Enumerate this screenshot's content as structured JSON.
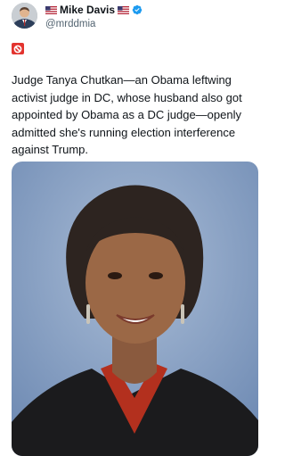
{
  "author": {
    "display_name": "Mike Davis",
    "handle": "@mrddmia",
    "avatar_icon": "avatar-photo",
    "flag_icon": "us-flag-icon",
    "verified_icon": "verified-badge-icon",
    "verified_color": "#1d9bf0"
  },
  "badge": {
    "icon": "no-entry-emoji-icon",
    "color": "#e3342f"
  },
  "post": {
    "text": "Judge Tanya Chutkan—an Obama leftwing\nactivist judge in DC, whose husband also got\nappointed by Obama as a DC judge—openly\nadmitted she's running election interference\nagainst Trump."
  },
  "media": {
    "background_color": "#8aa3c6"
  }
}
